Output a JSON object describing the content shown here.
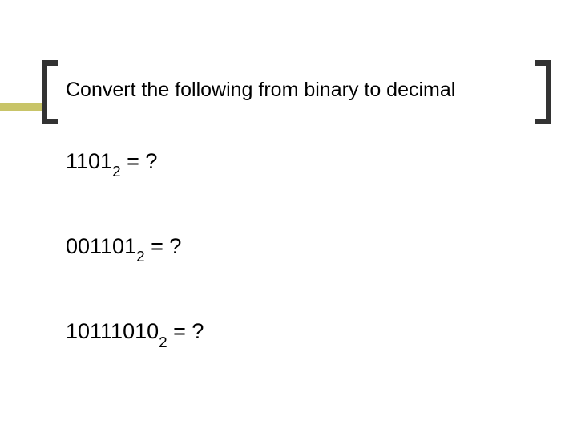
{
  "title": "Convert the following from binary to decimal",
  "problems": [
    {
      "digits": "1101",
      "base": "2",
      "rhs": " = ?"
    },
    {
      "digits": "001101",
      "base": "2",
      "rhs": " = ?"
    },
    {
      "digits": "10111010",
      "base": "2",
      "rhs": " = ?"
    }
  ]
}
